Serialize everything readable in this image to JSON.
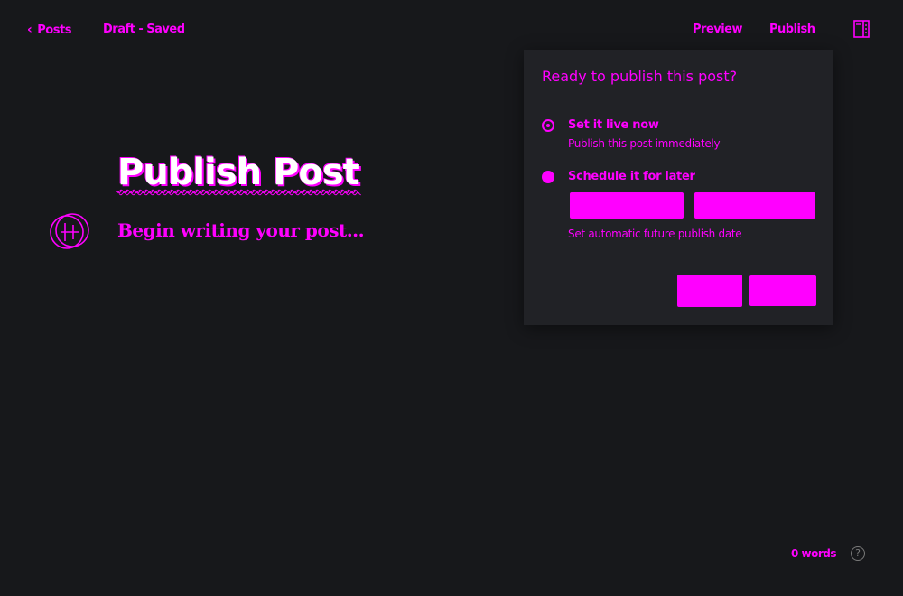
{
  "topbar": {
    "back_label": "Posts",
    "status": "Draft - Saved",
    "preview_label": "Preview",
    "publish_label": "Publish"
  },
  "editor": {
    "title": "Publish Post",
    "body_placeholder": "Begin writing your post..."
  },
  "publish_panel": {
    "title": "Ready to publish this post?",
    "options": [
      {
        "label": "Set it live now",
        "description": "Publish this post immediately",
        "selected": true
      },
      {
        "label": "Schedule it for later",
        "selected": false
      }
    ],
    "schedule_hint": "Set automatic future publish date",
    "date_value": "",
    "time_value": "",
    "cancel_label": "",
    "confirm_label": ""
  },
  "footer": {
    "word_count": "0 words",
    "help_label": "?"
  },
  "icons": {
    "back": "chevron-left-icon",
    "settings": "settings-panel-icon",
    "card": "add-card-icon",
    "help": "help-icon"
  },
  "colors": {
    "background": "#17181b",
    "panel": "#212226",
    "accent": "#ff00ff",
    "title_text": "#ffffff"
  }
}
